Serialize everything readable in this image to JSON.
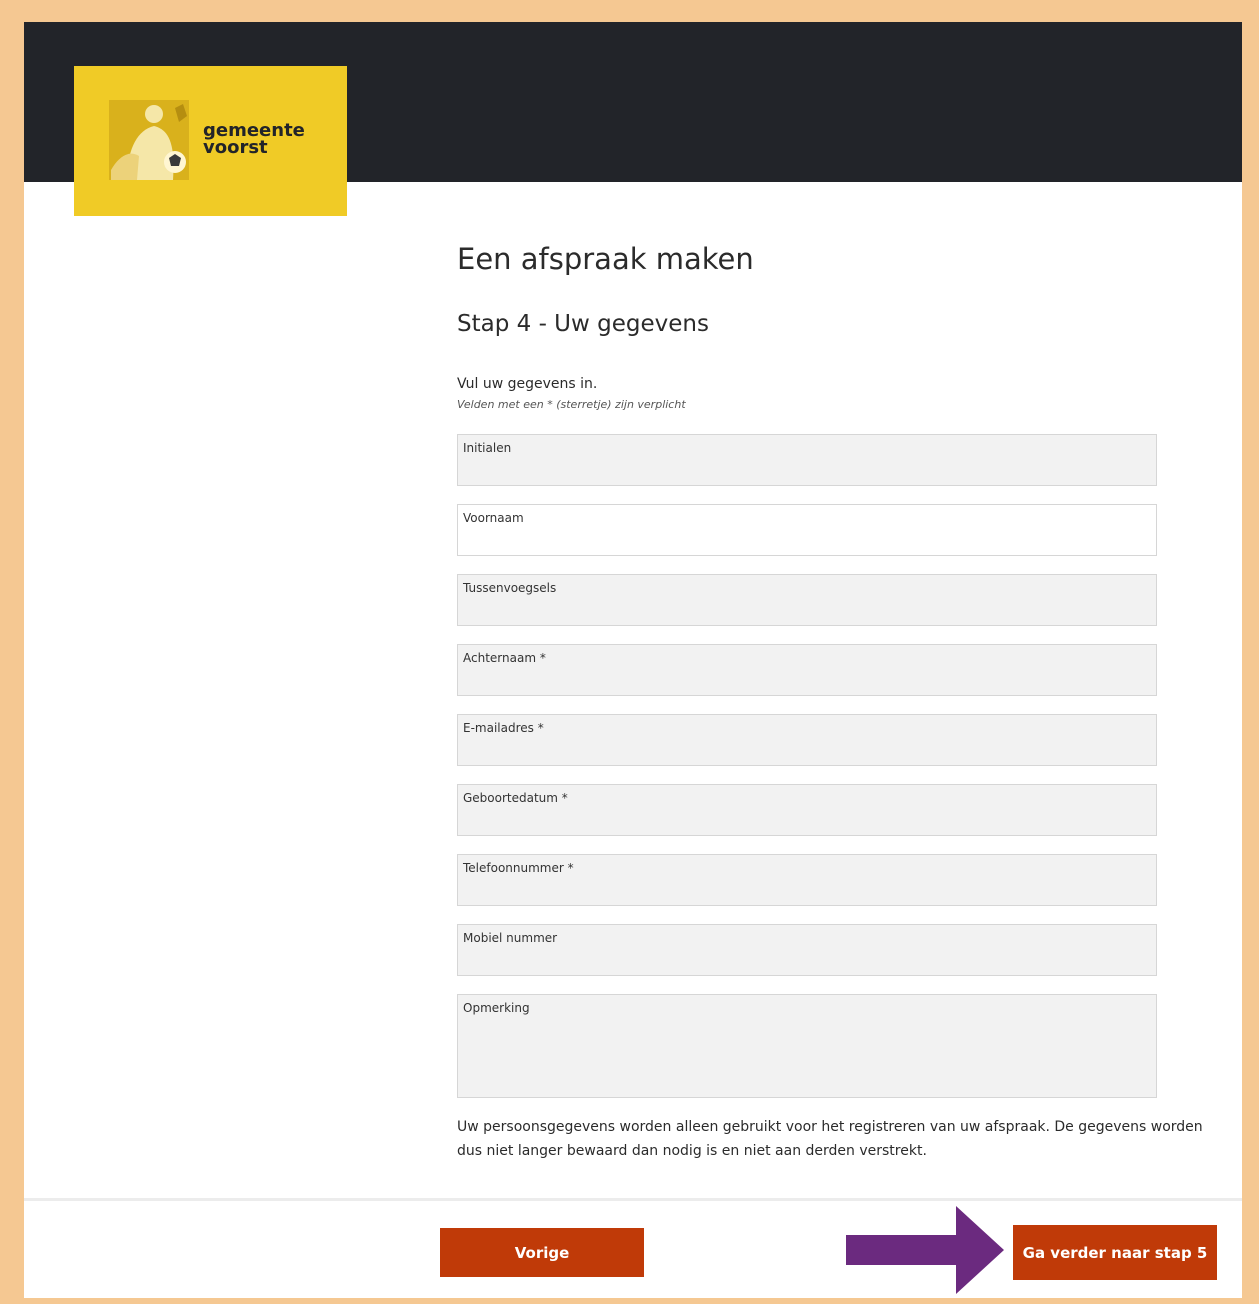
{
  "header": {
    "logo_line1": "gemeente",
    "logo_line2": "voorst",
    "brand_color": "#f0cb26",
    "bar_color": "#222429"
  },
  "page": {
    "title": "Een afspraak maken",
    "step_title": "Stap 4 - Uw gegevens",
    "intro": "Vul uw gegevens in.",
    "required_note": "Velden met een * (sterretje) zijn verplicht"
  },
  "form": {
    "fields": [
      {
        "label": "Initialen",
        "value": ""
      },
      {
        "label": "Voornaam",
        "value": ""
      },
      {
        "label": "Tussenvoegsels",
        "value": ""
      },
      {
        "label": "Achternaam *",
        "value": ""
      },
      {
        "label": "E-mailadres *",
        "value": ""
      },
      {
        "label": "Geboortedatum *",
        "value": ""
      },
      {
        "label": "Telefoonnummer *",
        "value": ""
      },
      {
        "label": "Mobiel nummer",
        "value": ""
      },
      {
        "label": "Opmerking",
        "value": ""
      }
    ]
  },
  "privacy_text": "Uw persoonsgegevens worden alleen gebruikt voor het registreren van uw afspraak. De gegevens worden dus niet langer bewaard dan nodig is en niet aan derden verstrekt.",
  "footer": {
    "prev_label": "Vorige",
    "next_label": "Ga verder naar stap 5",
    "button_color": "#c03a08",
    "arrow_color": "#6b2a7f"
  }
}
